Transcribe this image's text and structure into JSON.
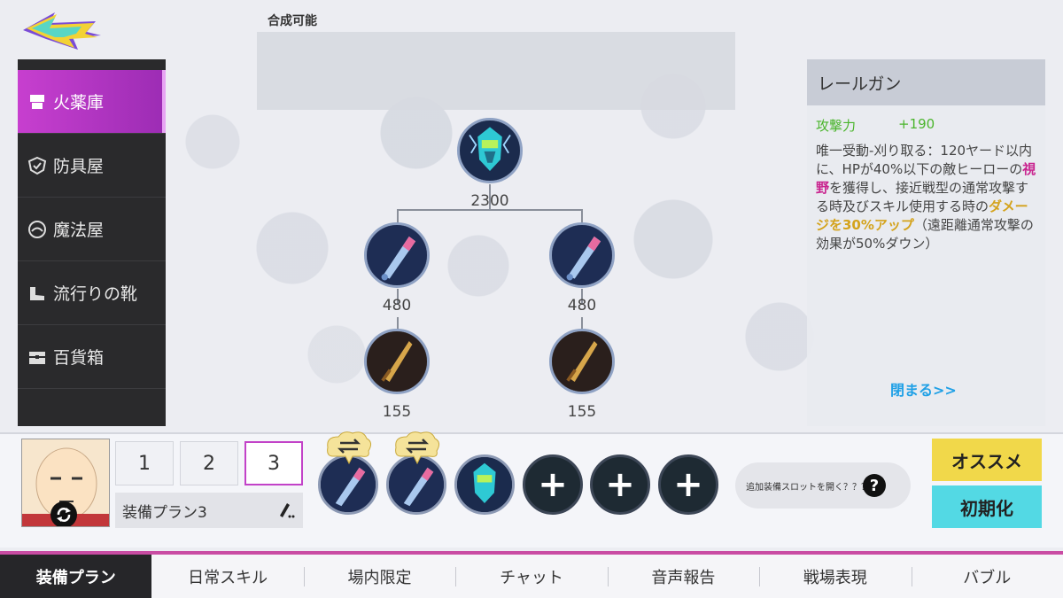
{
  "header": {
    "compose_label": "合成可能"
  },
  "sidebar": {
    "items": [
      {
        "label": "火薬庫",
        "icon": "armory-icon",
        "active": true
      },
      {
        "label": "防具屋",
        "icon": "armor-shop-icon",
        "active": false
      },
      {
        "label": "魔法屋",
        "icon": "magic-shop-icon",
        "active": false
      },
      {
        "label": "流行りの靴",
        "icon": "boots-icon",
        "active": false
      },
      {
        "label": "百貨箱",
        "icon": "chest-icon",
        "active": false
      }
    ]
  },
  "tree": {
    "root": {
      "cost": "2300",
      "icon": "railgun-icon"
    },
    "mid": [
      {
        "cost": "480",
        "icon": "bat-icon"
      },
      {
        "cost": "480",
        "icon": "bat-icon"
      }
    ],
    "leaf": [
      {
        "cost": "155",
        "icon": "dagger-icon"
      },
      {
        "cost": "155",
        "icon": "dagger-icon"
      }
    ]
  },
  "detail": {
    "title": "レールガン",
    "stat_name": "攻撃力",
    "stat_value": "+190",
    "desc_1": "唯一受動-刈り取る：120ヤード以内に、HPが40%以下の敵ヒーローの",
    "desc_2": "視野",
    "desc_3": "を獲得し、接近戦型の通常攻撃する時及びスキル使用する時の",
    "desc_4": "ダメージを30%アップ",
    "desc_5": "（遠距離通常攻撃の効果が50%ダウン）",
    "close": "閉まる>>"
  },
  "plans": {
    "buttons": [
      "1",
      "2",
      "3"
    ],
    "active": "3",
    "name": "装備プラン3"
  },
  "slots": {
    "info": "追加装備スロットを開く？？？？",
    "help": "?",
    "plus": "+"
  },
  "actions": {
    "recommend": "オススメ",
    "reset": "初期化"
  },
  "tabs": [
    "装備プラン",
    "日常スキル",
    "場内限定",
    "チャット",
    "音声報告",
    "戦場表現",
    "バブル"
  ],
  "colors": {
    "accent": "#c242c8",
    "stat_green": "#4ab52c",
    "highlight_pink": "#c9248f",
    "highlight_gold": "#d4a31c",
    "link_blue": "#1fa0e6",
    "recommend_yellow": "#f1d84a",
    "reset_cyan": "#53d9e4"
  }
}
